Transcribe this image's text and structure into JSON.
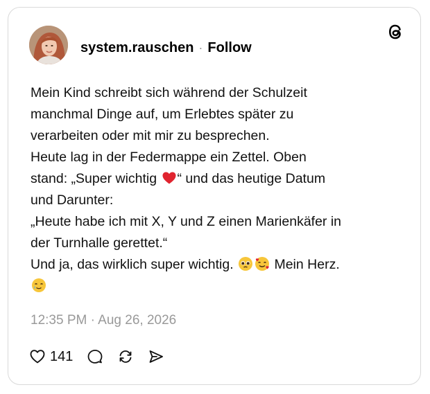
{
  "post": {
    "username": "system.rauschen",
    "separator": "·",
    "follow_label": "Follow",
    "lines": {
      "l1": "Mein Kind schreibt sich während der Schulzeit",
      "l2": "manchmal Dinge auf, um Erlebtes später zu",
      "l3": "verarbeiten oder mit mir zu besprechen.",
      "l4": "Heute lag in der Federmappe ein Zettel. Oben",
      "l5a": "stand: „Super wichtig ",
      "l5b": "“ und das heutige Datum",
      "l6": "und Darunter:",
      "l7": "„Heute habe ich mit X, Y und Z einen Marienkäfer in",
      "l8": "der Turnhalle gerettet.“",
      "l9a": "Und ja, das wirklich super wichtig. ",
      "l9b": " Mein Herz."
    },
    "emojis": [
      "red-heart",
      "pleading-face",
      "smiling-face-with-hearts",
      "smiling-face-with-tear"
    ],
    "timestamp": "12:35 PM · Aug 26, 2026",
    "like_count": "141"
  },
  "icons": {
    "like": "heart-outline-icon",
    "reply": "speech-bubble-icon",
    "repost": "repost-icon",
    "share": "send-icon",
    "brand": "threads-logo-icon"
  },
  "colors": {
    "text": "#111111",
    "muted": "#999999",
    "border": "#d9d9d9",
    "heart": "#e0245e"
  }
}
